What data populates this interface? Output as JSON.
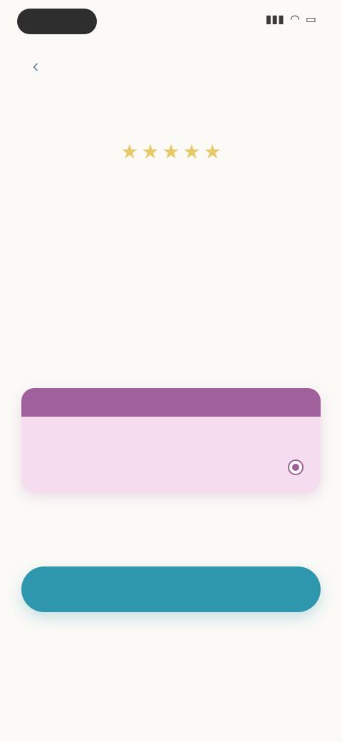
{
  "status_bar": {
    "pill_label": "",
    "icons": [
      "signal-icon",
      "wifi-icon",
      "battery-icon"
    ]
  },
  "nav": {
    "back_icon": "‹"
  },
  "hero": {
    "title": "",
    "stars": [
      "★",
      "★",
      "★",
      "★",
      "★"
    ],
    "rating_text": "",
    "description": "",
    "link_text": ""
  },
  "plan": {
    "banner": "",
    "name": "",
    "price": "",
    "subtitle": ""
  },
  "alt_plan": {
    "name": "",
    "price": ""
  },
  "cta": {
    "label": "",
    "note": ""
  },
  "legal": {
    "text": ""
  },
  "footer": {
    "links": [
      "",
      ""
    ]
  },
  "colors": {
    "background": "#fbfaf7",
    "plan_banner": "#a0609c",
    "plan_card": "#f6dcef",
    "cta": "#2e96ad",
    "stars": "#e8c96a",
    "links": "#7bb8cc"
  }
}
